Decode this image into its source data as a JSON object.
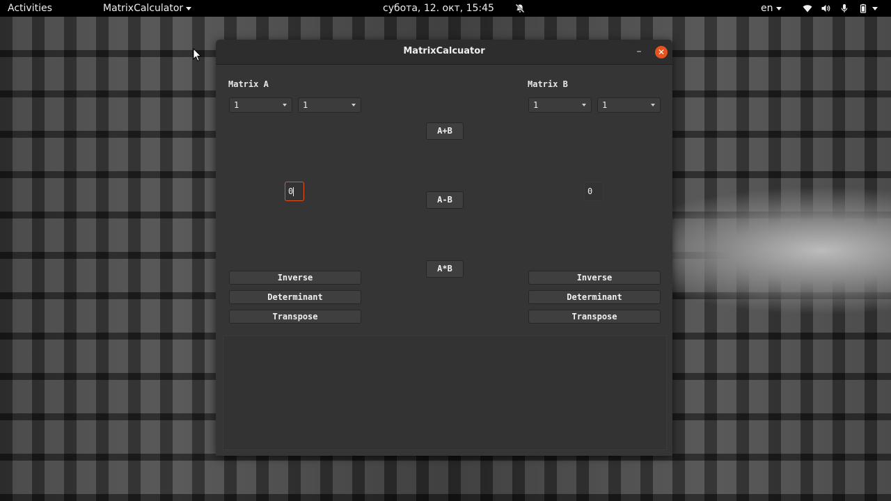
{
  "topbar": {
    "activities": "Activities",
    "app_menu": "MatrixCalculator",
    "clock": "субота, 12. окт, 15:45",
    "language": "en"
  },
  "window": {
    "title": "MatrixCalcuator",
    "minimize": "–",
    "close": "✕"
  },
  "matrix_a": {
    "label": "Matrix A",
    "rows_value": "1",
    "cols_value": "1",
    "cell_value": "0",
    "buttons": {
      "inverse": "Inverse",
      "determinant": "Determinant",
      "transpose": "Transpose"
    }
  },
  "matrix_b": {
    "label": "Matrix B",
    "rows_value": "1",
    "cols_value": "1",
    "cell_value": "0",
    "buttons": {
      "inverse": "Inverse",
      "determinant": "Determinant",
      "transpose": "Transpose"
    }
  },
  "operations": {
    "add": "A+B",
    "subtract": "A-B",
    "multiply": "A*B"
  },
  "colors": {
    "accent": "#e6531e",
    "window_bg": "#353535",
    "titlebar_bg": "#2d2d2d"
  },
  "icons": [
    "chevron-down-icon",
    "notifications-off-icon",
    "wifi-icon",
    "volume-icon",
    "microphone-icon",
    "battery-icon",
    "close-icon",
    "minimize-icon"
  ]
}
